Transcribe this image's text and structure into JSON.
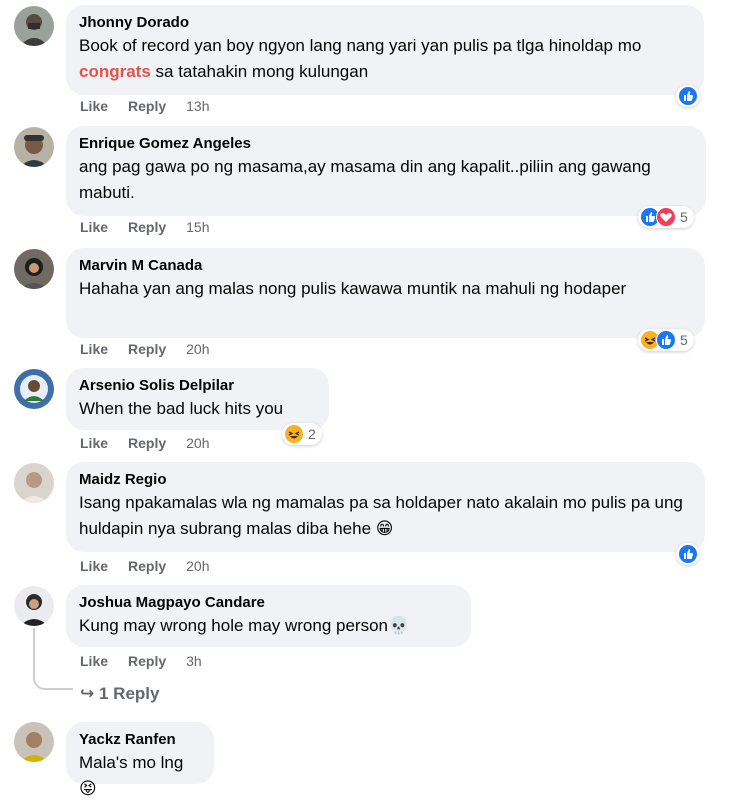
{
  "actions": {
    "like_label": "Like",
    "reply_label": "Reply"
  },
  "comments": [
    {
      "author": "Jhonny Dorado",
      "text_before": "Book of record yan boy ngyon lang nang yari yan pulis pa tlga hinoldap mo ",
      "highlight": "congrats",
      "text_after": " sa tatahakin mong kulungan",
      "time": "13h",
      "reactions": [
        "like"
      ],
      "count": ""
    },
    {
      "author": "Enrique Gomez Angeles",
      "text": "ang pag gawa po ng masama,ay masama din ang kapalit..piliin ang gawang mabuti.",
      "time": "15h",
      "reactions": [
        "like",
        "love"
      ],
      "count": "5"
    },
    {
      "author": "Marvin M Canada",
      "text": "Hahaha yan ang malas nong pulis kawawa muntik na mahuli ng hodaper",
      "time": "20h",
      "reactions": [
        "haha",
        "like"
      ],
      "count": "5"
    },
    {
      "author": "Arsenio Solis Delpilar",
      "text": "When the bad luck hits you",
      "time": "20h",
      "reactions": [
        "haha"
      ],
      "count": "2"
    },
    {
      "author": "Maidz Regio",
      "text": "Isang npakamalas wla ng mamalas pa sa holdaper nato akalain mo pulis pa ung huldapin nya subrang malas diba hehe 😁",
      "time": "20h",
      "reactions": [
        "like"
      ],
      "count": ""
    },
    {
      "author": "Joshua Magpayo Candare",
      "text": "Kung may wrong hole may wrong person💀",
      "time": "3h",
      "reactions": [],
      "count": ""
    },
    {
      "author": "Yackz Ranfen",
      "text": "Mala's mo lng 😝",
      "time": "",
      "reactions": [],
      "count": ""
    }
  ],
  "replies_link": "1 Reply",
  "colors": {
    "bubble": "#f0f2f5",
    "like": "#1877f2",
    "love": "#f33e58",
    "haha": "#f7b125",
    "highlight": "#e4524c",
    "meta": "#65676b"
  }
}
